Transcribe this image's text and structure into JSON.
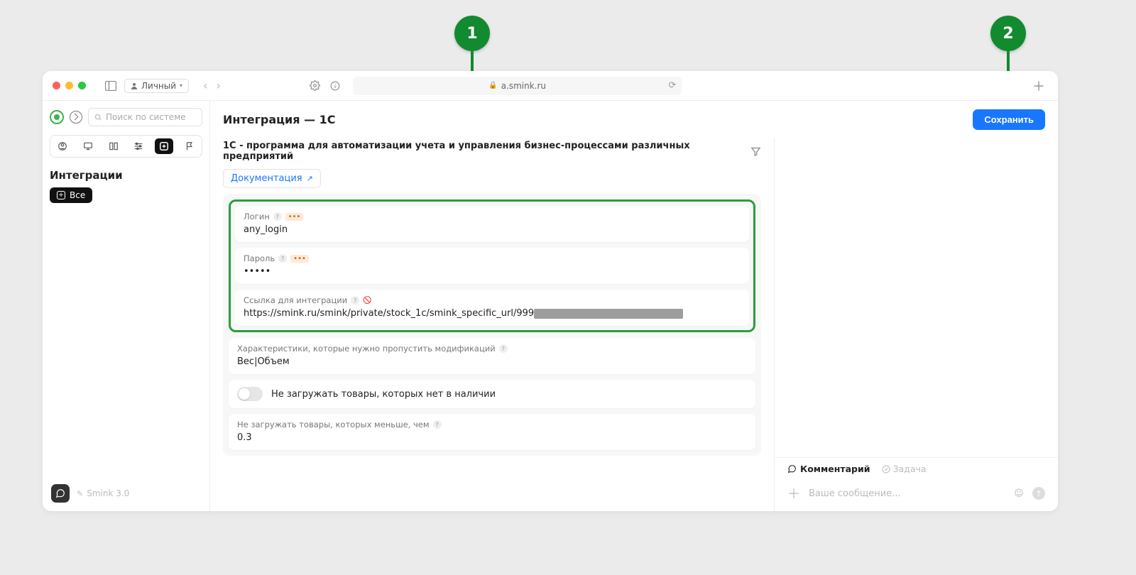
{
  "chrome": {
    "profile_label": "Личный",
    "url_host": "a.smink.ru"
  },
  "sidebar": {
    "search_placeholder": "Поиск по системе",
    "section_title": "Интеграции",
    "chip_all": "Все",
    "brand": "Smink 3.0"
  },
  "header": {
    "title": "Интеграция — 1С",
    "save": "Сохранить"
  },
  "content": {
    "description": "1С - программа для автоматизации учета и управления бизнес-процессами различных предприятий",
    "doc_link": "Документация",
    "fields": {
      "login": {
        "label": "Логин",
        "value": "any_login"
      },
      "password": {
        "label": "Пароль",
        "value": "•••••"
      },
      "integration_url": {
        "label": "Ссылка для интеграции",
        "value": "https://smink.ru/smink/private/stock_1c/smink_specific_url/999"
      },
      "skip_chars": {
        "label": "Характеристики, которые нужно пропустить модификаций",
        "value": "Вес|Объем"
      },
      "skip_out_of_stock": {
        "label": "Не загружать товары, которых нет в наличии"
      },
      "skip_less_than": {
        "label": "Не загружать товары, которых меньше, чем",
        "value": "0.3"
      }
    }
  },
  "right_pane": {
    "tab_comment": "Комментарий",
    "tab_task": "Задача",
    "input_placeholder": "Ваше сообщение..."
  },
  "annotations": {
    "badge1": "1",
    "badge2": "2"
  }
}
